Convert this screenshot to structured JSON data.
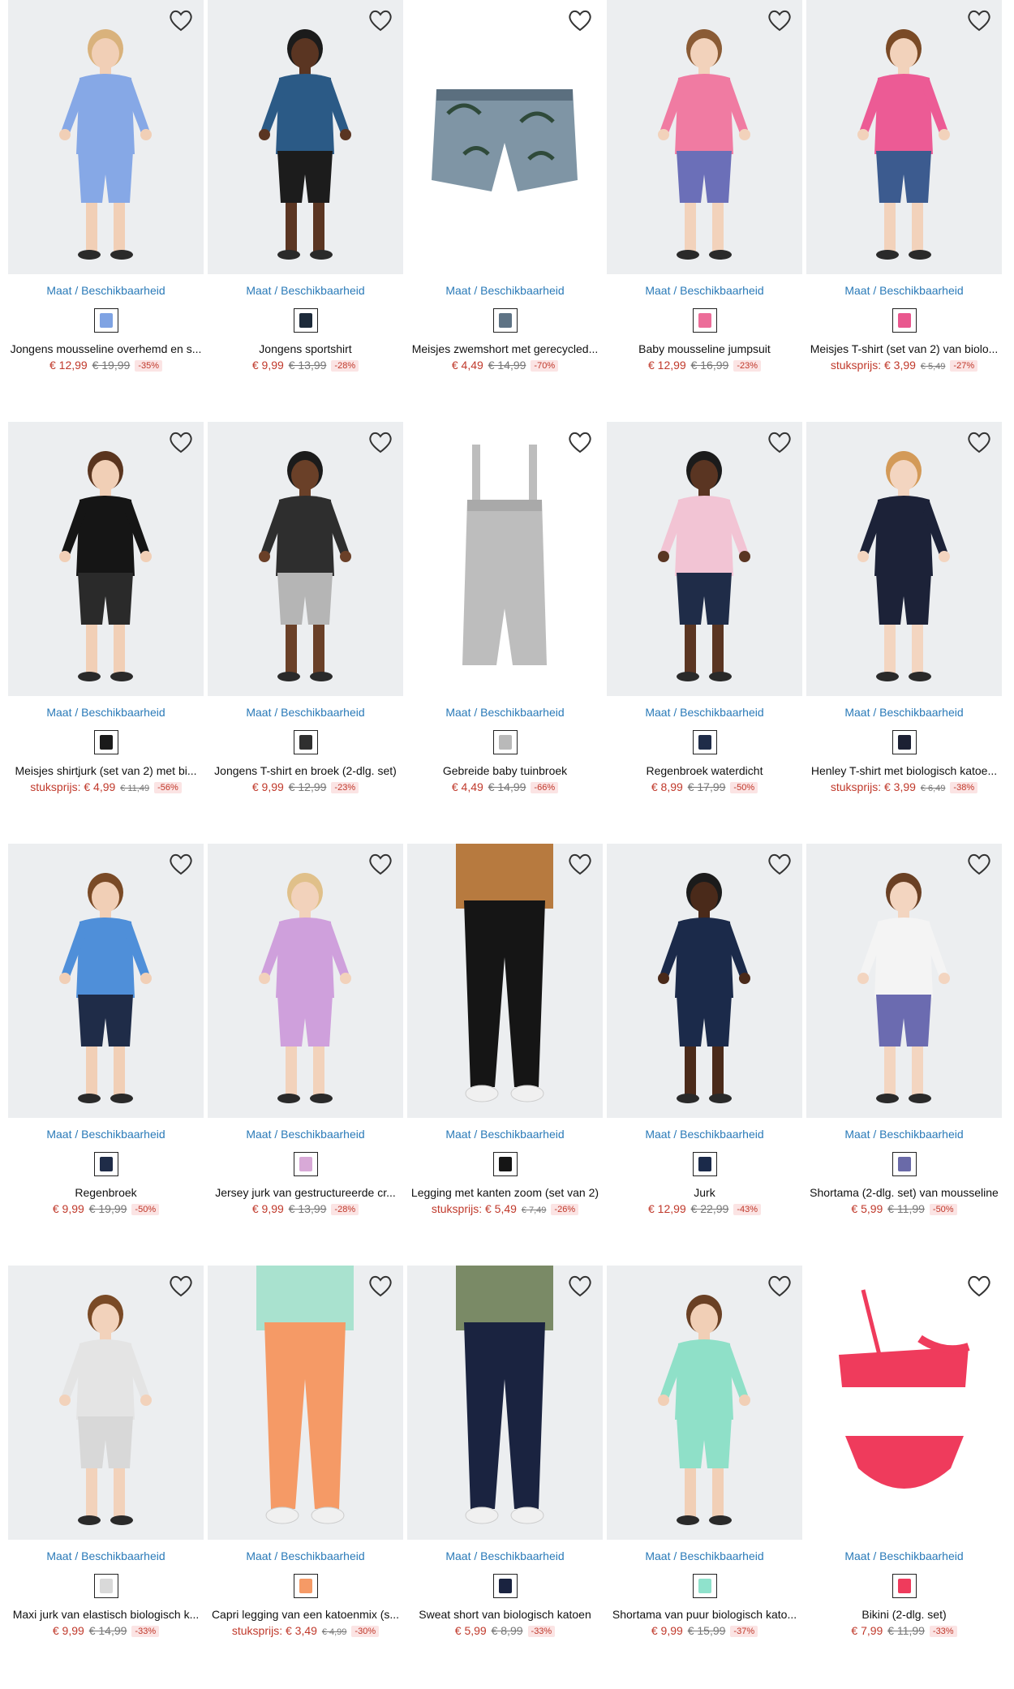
{
  "avail_label": "Maat / Beschikbaarheid",
  "products": [
    {
      "title": "Jongens mousseline overhemd en s...",
      "prefix": "",
      "price": "€ 12,99",
      "was": "€ 19,99",
      "discount": "-35%",
      "color": "#7fa3e3",
      "bg": "#eceef0",
      "fig": "child",
      "top": "#86a8e6",
      "bottom": "#86a8e6",
      "skin": "#f1cfb6",
      "hair": "#d9b27c"
    },
    {
      "title": "Jongens sportshirt",
      "prefix": "",
      "price": "€ 9,99",
      "was": "€ 13,99",
      "discount": "-28%",
      "color": "#1d2a3a",
      "bg": "#eceef0",
      "fig": "child",
      "top": "#2b5a86",
      "bottom": "#1c1c1c",
      "skin": "#5a3522",
      "hair": "#1b1b1b"
    },
    {
      "title": "Meisjes zwemshort met gerecycled...",
      "prefix": "",
      "price": "€ 4,49",
      "was": "€ 14,99",
      "discount": "-70%",
      "color": "#5e7385",
      "bg": "#ffffff",
      "fig": "shorts",
      "top": "#7f95a5",
      "bottom": "#7f95a5",
      "skin": "",
      "hair": ""
    },
    {
      "title": "Baby mousseline jumpsuit",
      "prefix": "",
      "price": "€ 12,99",
      "was": "€ 16,99",
      "discount": "-23%",
      "color": "#ec6d99",
      "bg": "#eceef0",
      "fig": "child",
      "top": "#f07ba2",
      "bottom": "#6b6fb8",
      "skin": "#f2d2bb",
      "hair": "#8a5b35"
    },
    {
      "title": "Meisjes T-shirt (set van 2) van biolo...",
      "prefix": "stuksprijs: ",
      "price": "€ 3,99",
      "was": "€ 5,49",
      "discount": "-27%",
      "color": "#e9578e",
      "bg": "#eceef0",
      "fig": "child",
      "top": "#ec5b95",
      "bottom": "#3c5b8f",
      "skin": "#f2d2bb",
      "hair": "#7a4a26"
    },
    {
      "title": "Meisjes shirtjurk (set van 2) met bi...",
      "prefix": "stuksprijs: ",
      "price": "€ 4,99",
      "was": "€ 11,49",
      "discount": "-56%",
      "color": "#1a1a1a",
      "bg": "#eceef0",
      "fig": "child",
      "top": "#151515",
      "bottom": "#2a2a2a",
      "skin": "#f1cfb6",
      "hair": "#5a351f"
    },
    {
      "title": "Jongens T-shirt en broek (2-dlg. set)",
      "prefix": "",
      "price": "€ 9,99",
      "was": "€ 12,99",
      "discount": "-23%",
      "color": "#2f2f2f",
      "bg": "#eceef0",
      "fig": "child",
      "top": "#2e2e2e",
      "bottom": "#b5b5b5",
      "skin": "#6a4028",
      "hair": "#1b1b1b"
    },
    {
      "title": "Gebreide baby tuinbroek",
      "prefix": "",
      "price": "€ 4,49",
      "was": "€ 14,99",
      "discount": "-66%",
      "color": "#b9b9b9",
      "bg": "#ffffff",
      "fig": "overall",
      "top": "#bdbdbd",
      "bottom": "#bdbdbd",
      "skin": "",
      "hair": ""
    },
    {
      "title": "Regenbroek waterdicht",
      "prefix": "",
      "price": "€ 8,99",
      "was": "€ 17,99",
      "discount": "-50%",
      "color": "#1f2c48",
      "bg": "#eceef0",
      "fig": "child",
      "top": "#f2c4d4",
      "bottom": "#1f2c48",
      "skin": "#5a3522",
      "hair": "#1b1b1b"
    },
    {
      "title": "Henley T-shirt met biologisch katoe...",
      "prefix": "stuksprijs: ",
      "price": "€ 3,99",
      "was": "€ 6,49",
      "discount": "-38%",
      "color": "#1c2033",
      "bg": "#eceef0",
      "fig": "child",
      "top": "#1c2238",
      "bottom": "#1c2238",
      "skin": "#f3d5c0",
      "hair": "#d39a58"
    },
    {
      "title": "Regenbroek",
      "prefix": "",
      "price": "€ 9,99",
      "was": "€ 19,99",
      "discount": "-50%",
      "color": "#1f2c48",
      "bg": "#eceef0",
      "fig": "child",
      "top": "#4f8fd9",
      "bottom": "#1f2c48",
      "skin": "#f1cfb6",
      "hair": "#7a4a26"
    },
    {
      "title": "Jersey jurk van gestructureerde cr...",
      "prefix": "",
      "price": "€ 9,99",
      "was": "€ 13,99",
      "discount": "-28%",
      "color": "#d8a9d7",
      "bg": "#eceef0",
      "fig": "child",
      "top": "#cfa0dc",
      "bottom": "#cfa0dc",
      "skin": "#f2d2bb",
      "hair": "#e0c08a"
    },
    {
      "title": "Legging met kanten zoom (set van 2)",
      "prefix": "stuksprijs: ",
      "price": "€ 5,49",
      "was": "€ 7,49",
      "discount": "-26%",
      "color": "#151515",
      "bg": "#eceef0",
      "fig": "legs",
      "top": "#b77a3f",
      "bottom": "#151515",
      "skin": "",
      "hair": ""
    },
    {
      "title": "Jurk",
      "prefix": "",
      "price": "€ 12,99",
      "was": "€ 22,99",
      "discount": "-43%",
      "color": "#1b2a4a",
      "bg": "#eceef0",
      "fig": "child",
      "top": "#1b2a4a",
      "bottom": "#1b2a4a",
      "skin": "#4a2a1a",
      "hair": "#1b1b1b"
    },
    {
      "title": "Shortama (2-dlg. set) van mousseline",
      "prefix": "",
      "price": "€ 5,99",
      "was": "€ 11,99",
      "discount": "-50%",
      "color": "#6a6aa8",
      "bg": "#eceef0",
      "fig": "child",
      "top": "#f4f4f4",
      "bottom": "#6b6bb0",
      "skin": "#f3d5c0",
      "hair": "#6a4024"
    },
    {
      "title": "Maxi jurk van elastisch biologisch k...",
      "prefix": "",
      "price": "€ 9,99",
      "was": "€ 14,99",
      "discount": "-33%",
      "color": "#d9d9d9",
      "bg": "#eceef0",
      "fig": "child",
      "top": "#e4e4e4",
      "bottom": "#d8d8d8",
      "skin": "#f2d2bb",
      "hair": "#7a4a26"
    },
    {
      "title": "Capri legging van een katoenmix (s...",
      "prefix": "stuksprijs: ",
      "price": "€ 3,49",
      "was": "€ 4,99",
      "discount": "-30%",
      "color": "#f59a66",
      "bg": "#eceef0",
      "fig": "legs",
      "top": "#a9e2cf",
      "bottom": "#f59a66",
      "skin": "",
      "hair": ""
    },
    {
      "title": "Sweat short van biologisch katoen",
      "prefix": "",
      "price": "€ 5,99",
      "was": "€ 8,99",
      "discount": "-33%",
      "color": "#1a2340",
      "bg": "#eceef0",
      "fig": "legs",
      "top": "#7a8a66",
      "bottom": "#1a2340",
      "skin": "",
      "hair": ""
    },
    {
      "title": "Shortama van puur biologisch kato...",
      "prefix": "",
      "price": "€ 9,99",
      "was": "€ 15,99",
      "discount": "-37%",
      "color": "#8fe2cc",
      "bg": "#eceef0",
      "fig": "child",
      "top": "#8fe0c8",
      "bottom": "#8fe0c8",
      "skin": "#f1cfb6",
      "hair": "#6a4024"
    },
    {
      "title": "Bikini (2-dlg. set)",
      "prefix": "",
      "price": "€ 7,99",
      "was": "€ 11,99",
      "discount": "-33%",
      "color": "#ef3b5c",
      "bg": "#ffffff",
      "fig": "bikini",
      "top": "#ef3b5c",
      "bottom": "#ef3b5c",
      "skin": "",
      "hair": ""
    }
  ]
}
